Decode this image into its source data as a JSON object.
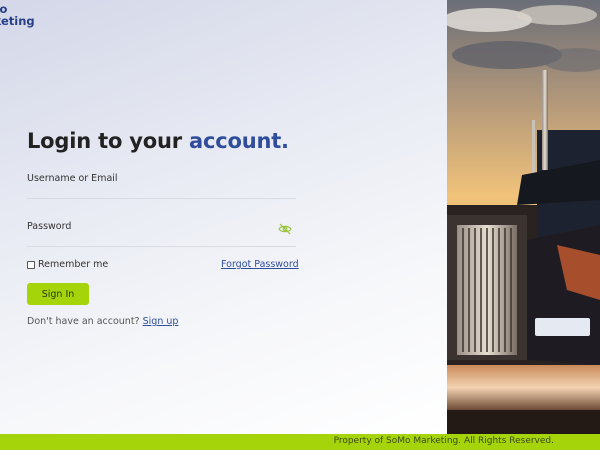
{
  "brand": {
    "logo_line1": "Mo",
    "logo_line2": "rketing"
  },
  "login": {
    "title_prefix": "Login to your ",
    "title_accent": "account.",
    "username_label": "Username or Email",
    "username_value": "",
    "password_label": "Password",
    "password_value": "",
    "password_toggle_icon": "eye-slash-icon",
    "remember_label": "Remember me",
    "remember_checked": false,
    "forgot_label": "Forgot Password",
    "signin_label": "Sign In",
    "signup_prompt": "Don't have an account?",
    "signup_label": "Sign up"
  },
  "hero": {
    "image": "semi-truck-sunset-photo"
  },
  "footer": {
    "text": "Property of SoMo Marketing. All Rights Reserved."
  },
  "colors": {
    "accent_blue": "#2f4d9a",
    "lime": "#a6d40b"
  }
}
